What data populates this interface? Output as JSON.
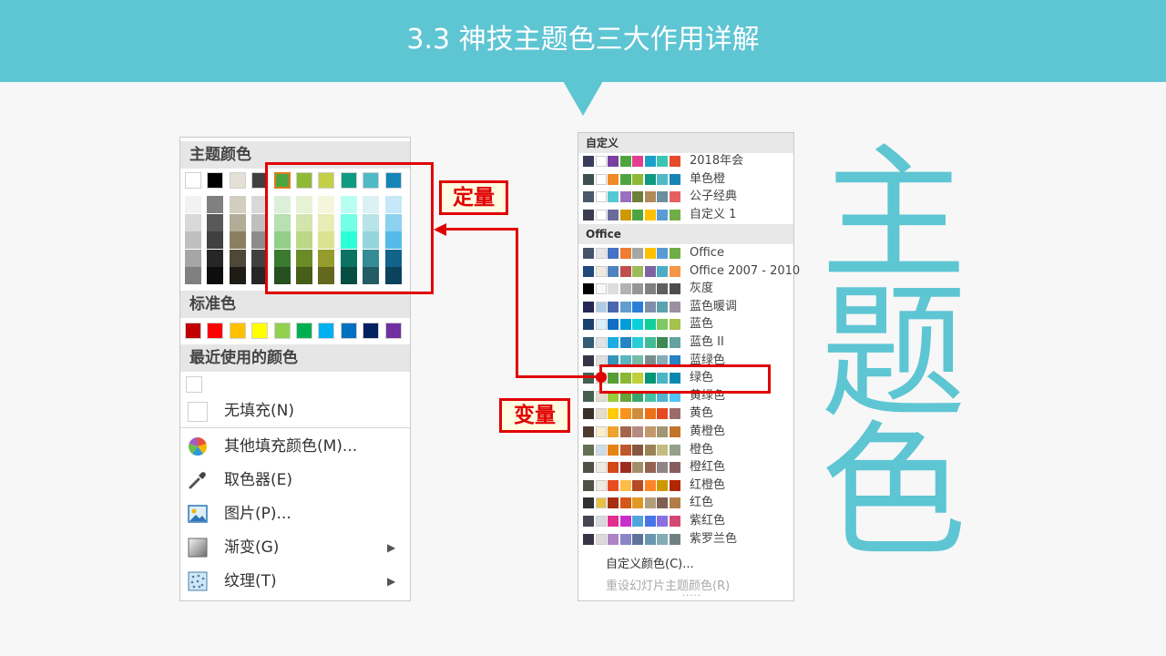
{
  "banner": {
    "title": "3.3 神技主题色三大作用详解"
  },
  "picker": {
    "theme_colors_heading": "主题颜色",
    "standard_colors_heading": "标准色",
    "recent_colors_heading": "最近使用的颜色",
    "theme_base": [
      "#ffffff",
      "#000000",
      "#e5e0d6",
      "#3f3f3f",
      "#4ea53f",
      "#8fba36",
      "#c5cf46",
      "#0f9a82",
      "#4fbac6",
      "#1585b8"
    ],
    "theme_tints": [
      [
        "#f2f2f2",
        "#d9d9d9",
        "#bfbfbf",
        "#a6a6a6",
        "#808080"
      ],
      [
        "#808080",
        "#595959",
        "#404040",
        "#262626",
        "#0d0d0d"
      ],
      [
        "#d2cdc1",
        "#b3ab98",
        "#8a8061",
        "#4e4838",
        "#1f1c15"
      ],
      [
        "#d8d8d8",
        "#bfbfbf",
        "#8c8c8c",
        "#404040",
        "#262626"
      ],
      [
        "#dcefd8",
        "#b8e0b0",
        "#93cf88",
        "#3a7b2f",
        "#274f1f"
      ],
      [
        "#e8f2d6",
        "#d2e5ad",
        "#bbd885",
        "#6b8b27",
        "#475d1a"
      ],
      [
        "#f3f6da",
        "#e8ecb5",
        "#dce390",
        "#959c2b",
        "#63681d"
      ],
      [
        "#b8fff2",
        "#72ffe6",
        "#2bffd9",
        "#0a7361",
        "#074d41"
      ],
      [
        "#dbf1f4",
        "#b8e3e9",
        "#94d5dd",
        "#358b95",
        "#235c63"
      ],
      [
        "#c6e8f8",
        "#8dd1f0",
        "#54bbe9",
        "#10638a",
        "#0b425c"
      ]
    ],
    "standard": [
      "#c00000",
      "#ff0000",
      "#ffc000",
      "#ffff00",
      "#92d050",
      "#00b050",
      "#00b0f0",
      "#0070c0",
      "#002060",
      "#7030a0"
    ],
    "no_fill": "无填充(N)",
    "menu": [
      {
        "label": "其他填充颜色(M)...",
        "icon": "palette-icon"
      },
      {
        "label": "取色器(E)",
        "icon": "eyedropper-icon"
      },
      {
        "label": "图片(P)...",
        "icon": "picture-icon"
      },
      {
        "label": "渐变(G)",
        "icon": "gradient-icon",
        "submenu": true
      },
      {
        "label": "纹理(T)",
        "icon": "texture-icon",
        "submenu": true
      }
    ]
  },
  "themes": {
    "custom_heading": "自定义",
    "office_heading": "Office",
    "custom": [
      {
        "name": "2018年会",
        "colors": [
          "#3b3b5c",
          "#ffffff",
          "#7b3fa0",
          "#4ea53f",
          "#e23d8f",
          "#1ba0c8",
          "#3cc5b4",
          "#e34b2a"
        ]
      },
      {
        "name": "单色橙",
        "colors": [
          "#3f4f4f",
          "#ffffff",
          "#f08a24",
          "#4ea53f",
          "#8fba36",
          "#0f9a82",
          "#4fbac6",
          "#1585b8"
        ]
      },
      {
        "name": "公子经典",
        "colors": [
          "#4a5a6a",
          "#ffffff",
          "#56c7d5",
          "#9b6fc0",
          "#6e7f3a",
          "#b08a5a",
          "#6b8f9f",
          "#e66060"
        ]
      },
      {
        "name": "自定义 1",
        "colors": [
          "#3c3c50",
          "#ffffff",
          "#6b6b9b",
          "#cc9900",
          "#4ea53f",
          "#ffc000",
          "#5b9bd5",
          "#70ad47"
        ]
      }
    ],
    "office": [
      {
        "name": "Office",
        "colors": [
          "#44546a",
          "#e7e6e6",
          "#4472c4",
          "#ed7d31",
          "#a5a5a5",
          "#ffc000",
          "#5b9bd5",
          "#70ad47"
        ]
      },
      {
        "name": "Office 2007 - 2010",
        "colors": [
          "#1f497d",
          "#eeece1",
          "#4f81bd",
          "#c0504d",
          "#9bbb59",
          "#8064a2",
          "#4bacc6",
          "#f79646"
        ]
      },
      {
        "name": "灰度",
        "colors": [
          "#000000",
          "#f8f8f8",
          "#dddddd",
          "#b2b2b2",
          "#969696",
          "#808080",
          "#5f5f5f",
          "#4d4d4d"
        ]
      },
      {
        "name": "蓝色暖调",
        "colors": [
          "#242852",
          "#acccea",
          "#4a66ac",
          "#629dd1",
          "#297fd5",
          "#7f8fa9",
          "#5aa2ae",
          "#9d90a0"
        ]
      },
      {
        "name": "蓝色",
        "colors": [
          "#17406d",
          "#dbeff9",
          "#0f6fc6",
          "#009dd9",
          "#0bd0d9",
          "#10cf9b",
          "#7cca62",
          "#a5c249"
        ]
      },
      {
        "name": "蓝色 II",
        "colors": [
          "#335b74",
          "#dfe3e5",
          "#1cade4",
          "#2683c6",
          "#27ced7",
          "#42ba97",
          "#3e8853",
          "#62a39f"
        ]
      },
      {
        "name": "蓝绿色",
        "colors": [
          "#373545",
          "#dedede",
          "#3494ba",
          "#58b6c0",
          "#75bda7",
          "#7a8c8e",
          "#84acb6",
          "#2683c6"
        ]
      },
      {
        "name": "绿色",
        "colors": [
          "#455f51",
          "#e3ded1",
          "#549e39",
          "#8ab833",
          "#c0cf3a",
          "#029676",
          "#4ab5c4",
          "#0989b1"
        ]
      },
      {
        "name": "黄绿色",
        "colors": [
          "#455f51",
          "#e3ded1",
          "#99cb38",
          "#63a537",
          "#37a76f",
          "#44c1a3",
          "#4eb3cf",
          "#51c3f9"
        ]
      },
      {
        "name": "黄色",
        "colors": [
          "#39302a",
          "#e5dec9",
          "#ffca08",
          "#f8931d",
          "#ce8d3e",
          "#ec7016",
          "#e64823",
          "#9c6a6a"
        ]
      },
      {
        "name": "黄橙色",
        "colors": [
          "#4e3b30",
          "#fbeec9",
          "#f0a22e",
          "#a5644e",
          "#b58b80",
          "#c3986d",
          "#a19574",
          "#c17529"
        ]
      },
      {
        "name": "橙色",
        "colors": [
          "#637052",
          "#ccddea",
          "#e48312",
          "#bd582c",
          "#865640",
          "#9b8357",
          "#c2bc80",
          "#94a088"
        ]
      },
      {
        "name": "橙红色",
        "colors": [
          "#505046",
          "#eeece1",
          "#d34817",
          "#9b2d1f",
          "#a28e6a",
          "#956251",
          "#918485",
          "#855d5d"
        ]
      },
      {
        "name": "红橙色",
        "colors": [
          "#505046",
          "#eeece1",
          "#e84c22",
          "#ffbd47",
          "#b64926",
          "#ff8427",
          "#cc9900",
          "#b22600"
        ]
      },
      {
        "name": "红色",
        "colors": [
          "#323232",
          "#e5c243",
          "#a5300f",
          "#d55816",
          "#e19825",
          "#b19c7d",
          "#7f5f52",
          "#b27d49"
        ]
      },
      {
        "name": "紫红色",
        "colors": [
          "#454551",
          "#d8d9dc",
          "#e32d91",
          "#c830cc",
          "#4ea6dc",
          "#4775e7",
          "#8971e1",
          "#d54773"
        ]
      },
      {
        "name": "紫罗兰色",
        "colors": [
          "#373545",
          "#dcd8dc",
          "#ad84c6",
          "#8784c7",
          "#5d739a",
          "#6997af",
          "#84acb6",
          "#6f8183"
        ]
      }
    ],
    "custom_colors": "自定义颜色(C)...",
    "reset_colors": "重设幻灯片主题颜色(R)",
    "dots": "....."
  },
  "annotations": {
    "fixed_label": "定量",
    "variable_label": "变量",
    "color": "#e00000"
  },
  "big_word": [
    "主",
    "题",
    "色"
  ],
  "accent_color": "#5ec5d3"
}
